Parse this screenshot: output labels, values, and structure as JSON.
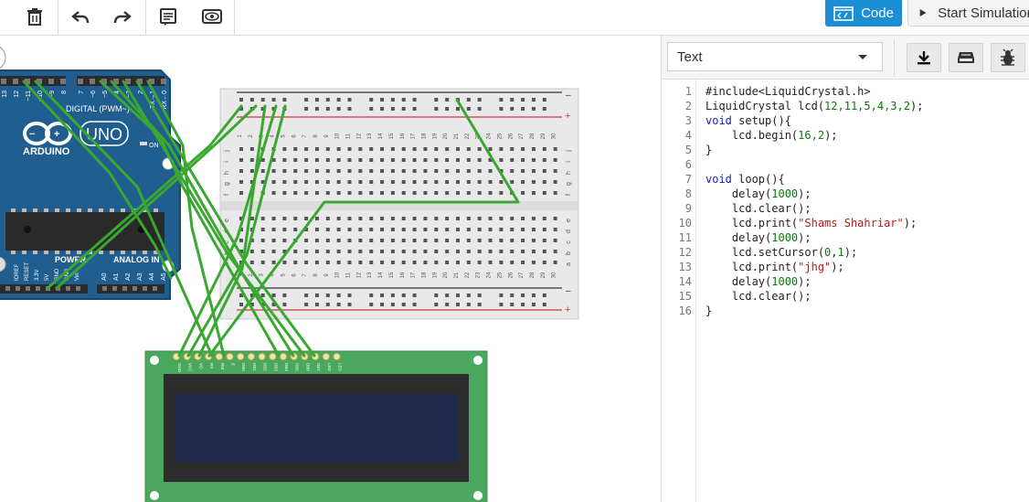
{
  "toolbar": {
    "code_label": "Code",
    "start_sim_label": "Start Simulation",
    "icons": [
      "trash-icon",
      "undo-icon",
      "redo-icon",
      "notes-icon",
      "visibility-icon"
    ]
  },
  "panel": {
    "editor_mode": "Text",
    "buttons": [
      "download-icon",
      "library-icon",
      "debug-icon"
    ]
  },
  "code": {
    "line_numbers": [
      "1",
      "2",
      "3",
      "4",
      "5",
      "6",
      "7",
      "8",
      "9",
      "10",
      "11",
      "12",
      "13",
      "14",
      "15",
      "16"
    ],
    "l1": "#include<LiquidCrystal.h>",
    "l2a": "LiquidCrystal lcd(",
    "l2b": "12,11,5,4,3,2",
    "l2c": ");",
    "l3a": "void",
    "l3b": " setup(){",
    "l4a": "    lcd.begin(",
    "l4b": "16,2",
    "l4c": ");",
    "l5": "}",
    "l7a": "void",
    "l7b": " loop(){",
    "l8a": "    delay(",
    "l8b": "1000",
    "l8c": ");",
    "l9": "    lcd.clear();",
    "l10a": "    lcd.print(",
    "l10b": "\"Shams Shahriar\"",
    "l10c": ");",
    "l11a": "    delay(",
    "l11b": "1000",
    "l11c": ");",
    "l12a": "    lcd.setCursor(",
    "l12b": "0",
    "l12c": ",",
    "l12d": "1",
    "l12e": ");",
    "l13a": "    lcd.print(",
    "l13b": "\"jhg\"",
    "l13c": ");",
    "l14a": "    delay(",
    "l14b": "1000",
    "l14c": ");",
    "l15": "    lcd.clear();",
    "l16": "}"
  },
  "arduino": {
    "brand": "ARDUINO",
    "model": "UNO",
    "digital_label": "DIGITAL (PWM~)",
    "power_label": "POWER",
    "analog_label": "ANALOG IN",
    "on_label": "ON",
    "power_pins": [
      "IOREF",
      "RESET",
      "3.3V",
      "5V",
      "GND",
      "GND",
      "Vin"
    ],
    "analog_pins": [
      "A0",
      "A1",
      "A2",
      "A3",
      "A4",
      "A5"
    ],
    "digital_pins": [
      "13",
      "12",
      "~11",
      "~10",
      "~9",
      "8",
      "7",
      "~6",
      "~5",
      "4",
      "~3",
      "2",
      "TX→1",
      "RX←0"
    ]
  },
  "breadboard": {
    "rows_top": [
      "j",
      "i",
      "h",
      "g",
      "f"
    ],
    "rows_bottom": [
      "e",
      "d",
      "c",
      "b",
      "a"
    ],
    "columns": [
      "1",
      "2",
      "3",
      "4",
      "5",
      "6",
      "7",
      "8",
      "9",
      "10",
      "11",
      "12",
      "13",
      "14",
      "15",
      "16",
      "17",
      "18",
      "19",
      "20",
      "21",
      "22",
      "23",
      "24",
      "25",
      "26",
      "27",
      "28",
      "29",
      "30"
    ],
    "minus": "–",
    "plus": "+"
  },
  "lcd": {
    "pins": [
      "GND",
      "VCC",
      "VO",
      "RS",
      "RW",
      "E",
      "DB0",
      "DB1",
      "DB2",
      "DB3",
      "DB4",
      "DB5",
      "DB6",
      "DB7",
      "LED",
      "LED"
    ]
  },
  "colors": {
    "accent": "#1a8fd6",
    "arduino": "#1f5e8f",
    "wire": "#3aa830",
    "lcd_board": "#4ba65e",
    "lcd_screen": "#1f2a4a"
  }
}
